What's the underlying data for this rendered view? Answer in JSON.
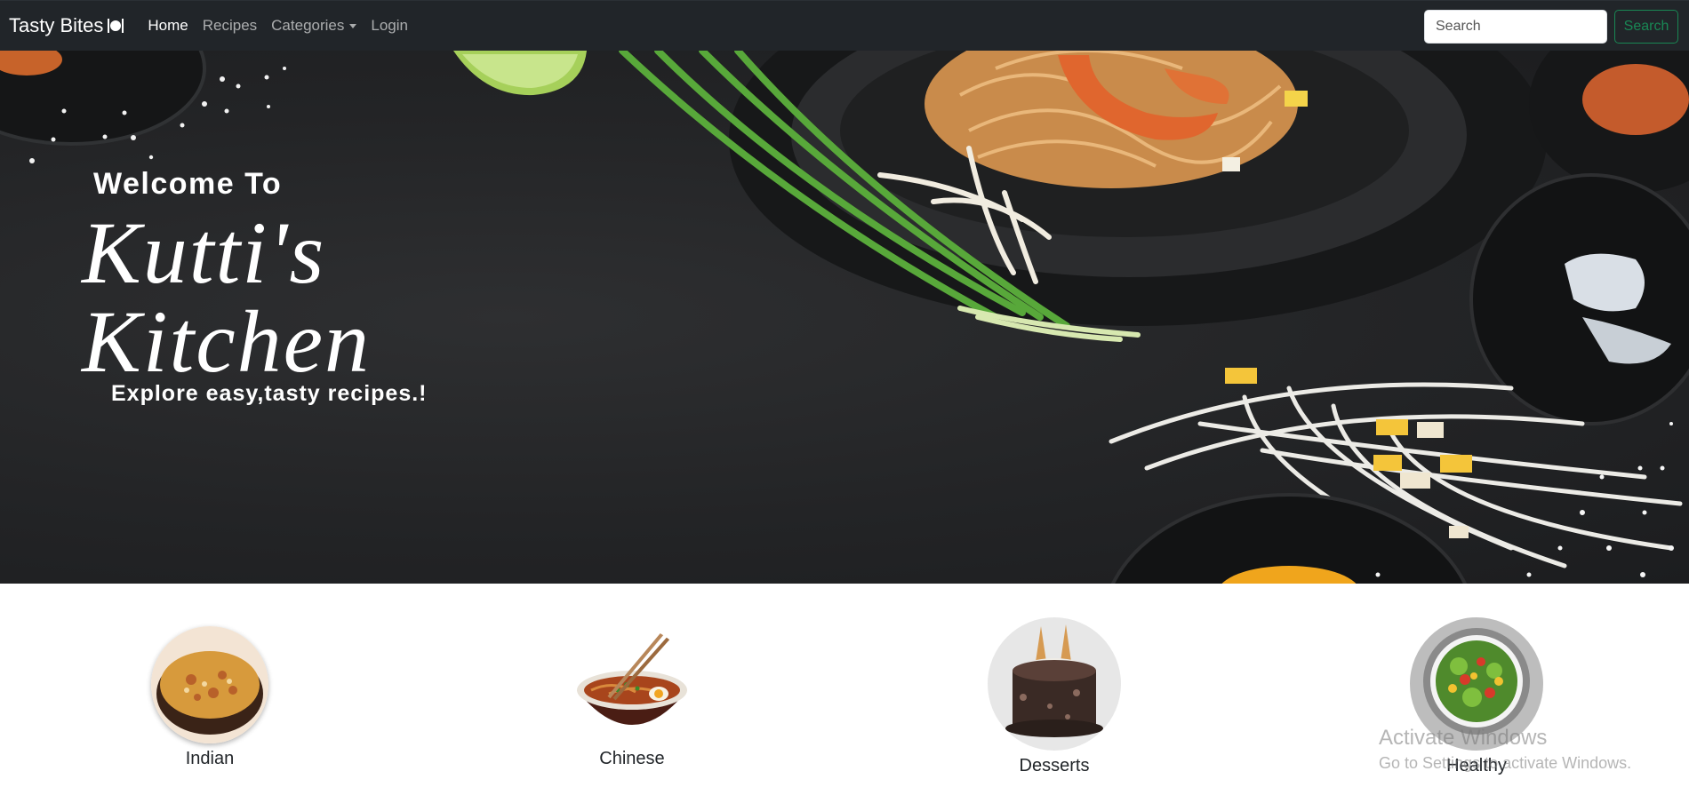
{
  "navbar": {
    "brand": "Tasty Bites",
    "links": [
      "Home",
      "Recipes",
      "Categories",
      "Login"
    ],
    "search_placeholder": "Search",
    "search_button": "Search"
  },
  "hero": {
    "welcome": "Welcome To",
    "title_line1": "Kutti's",
    "title_line2": "Kitchen",
    "tagline": "Explore easy,tasty recipes.!"
  },
  "categories": [
    {
      "label": "Indian",
      "image": "bowl-of-biryani"
    },
    {
      "label": "Chinese",
      "image": "bowl-of-noodles-with-chopsticks"
    },
    {
      "label": "Desserts",
      "image": "chocolate-cake-with-ice-cream-cones"
    },
    {
      "label": "Healthy",
      "image": "salad-bowl"
    }
  ],
  "watermark": {
    "title": "Activate Windows",
    "subtitle": "Go to Settings to activate Windows."
  },
  "colors": {
    "navbar_bg": "#212529",
    "search_button": "#198754",
    "hero_bg": "#232426"
  }
}
